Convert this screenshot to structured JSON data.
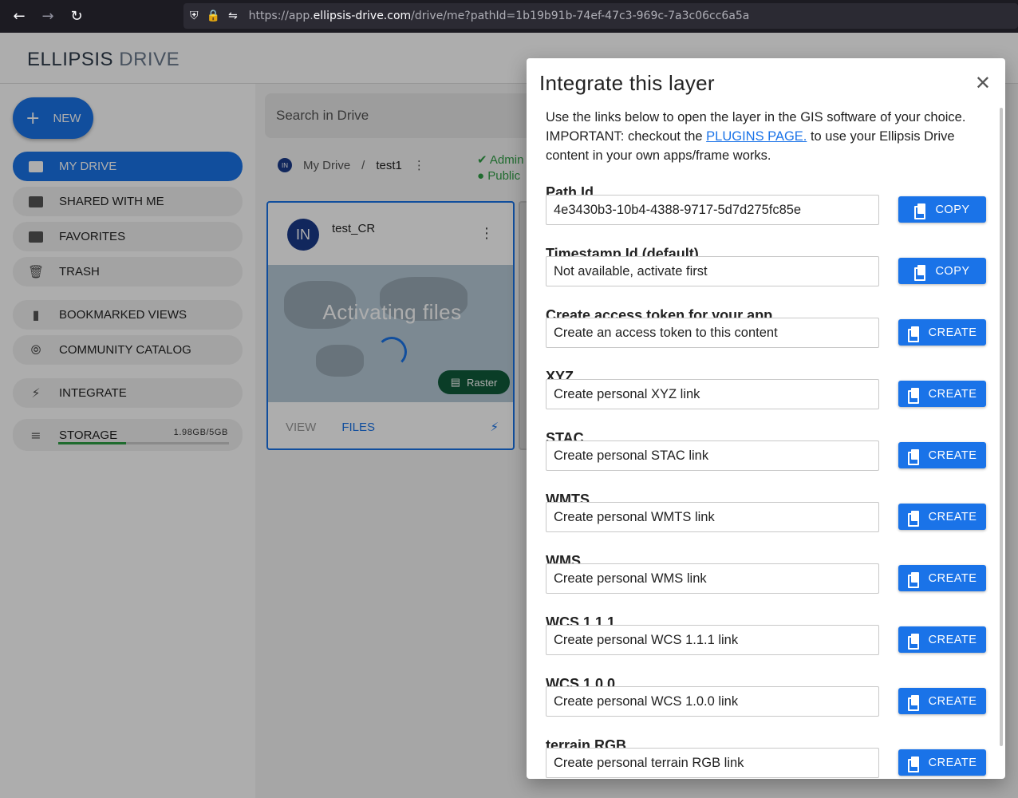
{
  "browser": {
    "url_prefix": "https://app.",
    "url_host": "ellipsis-drive.com",
    "url_rest": "/drive/me?pathId=1b19b91b-74ef-47c3-969c-7a3c06cc6a5a"
  },
  "app": {
    "logo_main": "ELLIPSIS",
    "logo_sub": "DRIVE",
    "new_label": "NEW",
    "sidebar": {
      "my_drive": "MY DRIVE",
      "shared": "SHARED WITH ME",
      "favorites": "FAVORITES",
      "trash": "TRASH",
      "bookmarked": "BOOKMARKED VIEWS",
      "community": "COMMUNITY CATALOG",
      "integrate": "INTEGRATE",
      "storage": "STORAGE",
      "storage_size": "1.98GB/5GB",
      "storage_fraction": 0.396
    },
    "search_placeholder": "Search in Drive",
    "breadcrumb": {
      "avatar": "IN",
      "root": "My Drive",
      "sep": "/",
      "current": "test1"
    },
    "permissions": {
      "admin": "Admin",
      "public": "Public"
    },
    "card": {
      "avatar": "IN",
      "name": "test_CR",
      "status": "Activating files",
      "type": "Raster",
      "view": "VIEW",
      "files": "FILES"
    }
  },
  "dialog": {
    "title": "Integrate this layer",
    "intro_1": "Use the links below to open the layer in the GIS software of your choice. IMPORTANT: checkout the ",
    "intro_link": "PLUGINS PAGE.",
    "intro_2": " to use your Ellipsis Drive content in your own apps/frame works.",
    "fields": [
      {
        "label": "Path Id",
        "value": "4e3430b3-10b4-4388-9717-5d7d275fc85e",
        "button": "COPY"
      },
      {
        "label": "Timestamp Id (default)",
        "value": "Not available, activate first",
        "button": "COPY"
      },
      {
        "label": "Create access token for your app",
        "value": "Create an access token to this content",
        "button": "CREATE"
      },
      {
        "label": "XYZ",
        "value": "Create personal XYZ link",
        "button": "CREATE"
      },
      {
        "label": "STAC",
        "value": "Create personal STAC link",
        "button": "CREATE"
      },
      {
        "label": "WMTS",
        "value": "Create personal WMTS link",
        "button": "CREATE"
      },
      {
        "label": "WMS",
        "value": "Create personal WMS link",
        "button": "CREATE"
      },
      {
        "label": "WCS 1.1.1",
        "value": "Create personal WCS 1.1.1 link",
        "button": "CREATE"
      },
      {
        "label": "WCS 1.0.0",
        "value": "Create personal WCS 1.0.0 link",
        "button": "CREATE"
      },
      {
        "label": "terrain RGB",
        "value": "Create personal terrain RGB link",
        "button": "CREATE"
      }
    ]
  }
}
